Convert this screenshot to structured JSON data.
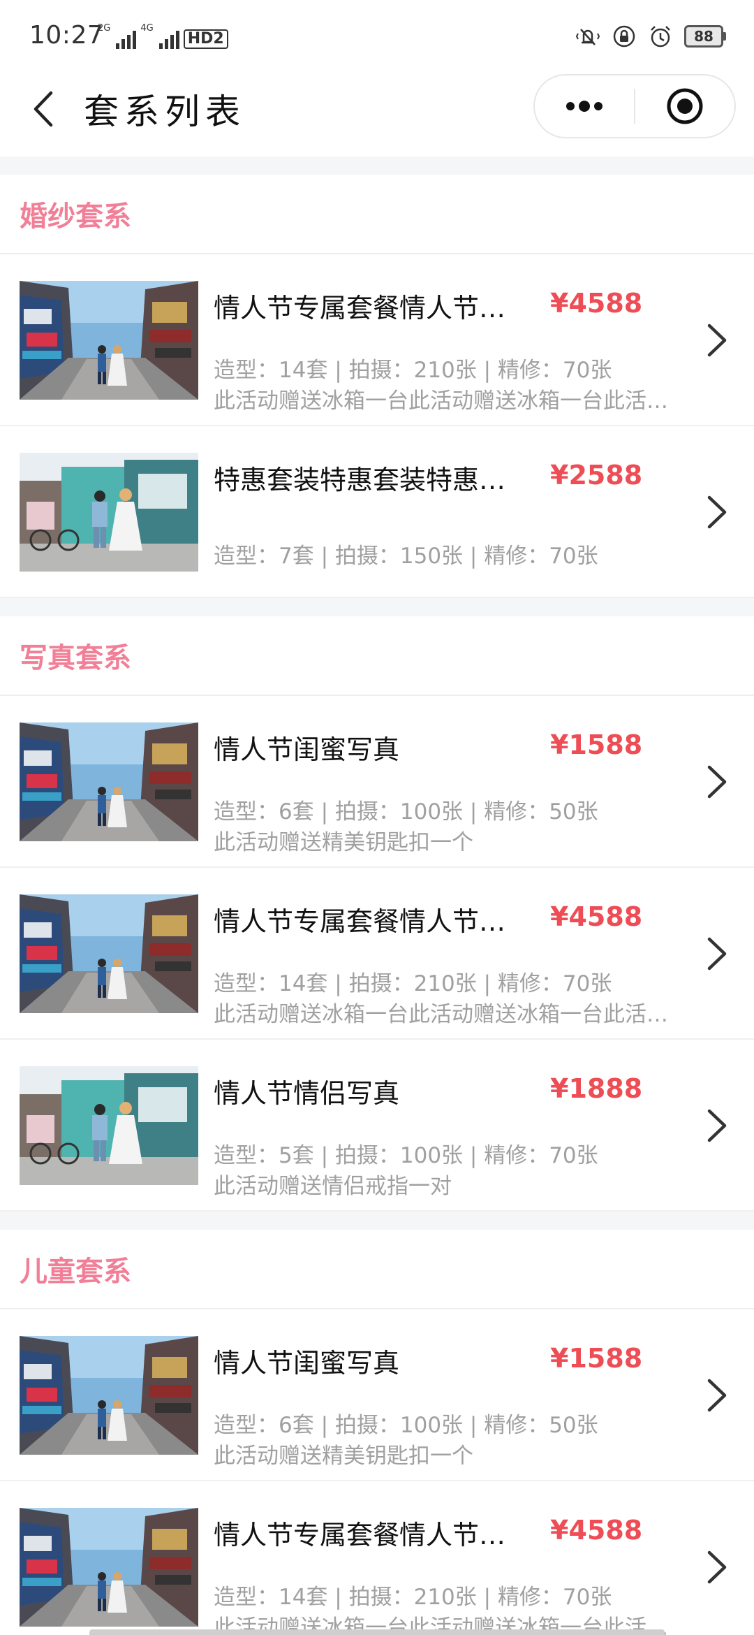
{
  "status_bar": {
    "time": "10:27",
    "sim1_label": "2G",
    "sim2_label": "4G",
    "hd_label": "HD2",
    "battery": "88",
    "icons": [
      "mute-vibrate-icon",
      "rotation-lock-icon",
      "alarm-icon",
      "battery-icon"
    ]
  },
  "nav": {
    "title": "套系列表",
    "back_icon": "chevron-left-icon",
    "more_icon": "more-dots-icon",
    "close_icon": "target-circle-icon"
  },
  "sections": [
    {
      "title": "婚纱套系",
      "items": [
        {
          "name": "情人节专属套餐情人节专属套餐",
          "price": "¥4588",
          "spec": "造型：14套 | 拍摄：210张 | 精修：70张",
          "desc": "此活动赠送冰箱一台此活动赠送冰箱一台此活动赠送冰箱一台",
          "photo": "street-couple-a"
        },
        {
          "name": "特惠套装特惠套装特惠套装",
          "price": "¥2588",
          "spec": "造型：7套 | 拍摄：150张 | 精修：70张",
          "desc": "",
          "photo": "street-couple-b"
        }
      ]
    },
    {
      "title": "写真套系",
      "items": [
        {
          "name": "情人节闺蜜写真",
          "price": "¥1588",
          "spec": "造型：6套 | 拍摄：100张 | 精修：50张",
          "desc": "此活动赠送精美钥匙扣一个",
          "photo": "street-couple-a"
        },
        {
          "name": "情人节专属套餐情人节专属套餐",
          "price": "¥4588",
          "spec": "造型：14套 | 拍摄：210张 | 精修：70张",
          "desc": "此活动赠送冰箱一台此活动赠送冰箱一台此活动赠送冰箱一台",
          "photo": "street-couple-a"
        },
        {
          "name": "情人节情侣写真",
          "price": "¥1888",
          "spec": "造型：5套 | 拍摄：100张 | 精修：70张",
          "desc": "此活动赠送情侣戒指一对",
          "photo": "street-couple-b"
        }
      ]
    },
    {
      "title": "儿童套系",
      "items": [
        {
          "name": "情人节闺蜜写真",
          "price": "¥1588",
          "spec": "造型：6套 | 拍摄：100张 | 精修：50张",
          "desc": "此活动赠送精美钥匙扣一个",
          "photo": "street-couple-a"
        },
        {
          "name": "情人节专属套餐情人节专属套餐",
          "price": "¥4588",
          "spec": "造型：14套 | 拍摄：210张 | 精修：70张",
          "desc": "此活动赠送冰箱一台此活动赠送冰箱一台此活动赠送冰箱一台",
          "photo": "street-couple-a"
        }
      ]
    }
  ],
  "colors": {
    "section_title": "#f07f97",
    "price": "#ee4d55",
    "spec_text": "#a0a0a0",
    "page_bg": "#f5f6f7"
  }
}
